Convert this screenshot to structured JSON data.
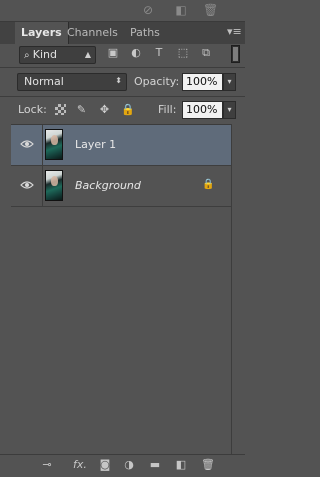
{
  "tabs": [
    {
      "label": "Layers",
      "active": true
    },
    {
      "label": "Channels",
      "active": false
    },
    {
      "label": "Paths",
      "active": false
    }
  ],
  "top_strip_icons": [
    "no-symbol-icon",
    "new-page-icon",
    "trash-icon"
  ],
  "filter": {
    "kind_label": "Kind",
    "icons": [
      "image-filter-icon",
      "adjustment-filter-icon",
      "type-filter-icon",
      "shape-filter-icon",
      "smart-object-filter-icon"
    ]
  },
  "blend": {
    "mode": "Normal",
    "opacity_label": "Opacity:",
    "opacity_value": "100%"
  },
  "lock": {
    "label": "Lock:",
    "fill_label": "Fill:",
    "fill_value": "100%"
  },
  "layers": [
    {
      "name": "Layer 1",
      "selected": true,
      "visible": true,
      "locked": false
    },
    {
      "name": "Background",
      "selected": false,
      "visible": true,
      "locked": true
    }
  ],
  "bottom_icons": [
    "link-icon",
    "fx-icon",
    "mask-icon",
    "adjustment-icon",
    "folder-icon",
    "new-layer-icon",
    "trash-icon"
  ],
  "fx_label": "fx."
}
